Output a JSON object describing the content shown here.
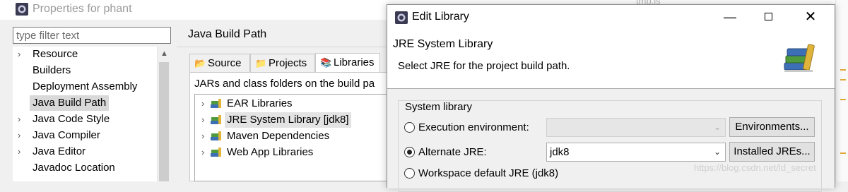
{
  "properties": {
    "title": "Properties for phant",
    "filter_placeholder": "type filter text",
    "nav": [
      {
        "label": "Resource",
        "expandable": true
      },
      {
        "label": "Builders",
        "expandable": false
      },
      {
        "label": "Deployment Assembly",
        "expandable": false
      },
      {
        "label": "Java Build Path",
        "expandable": false,
        "selected": true
      },
      {
        "label": "Java Code Style",
        "expandable": true
      },
      {
        "label": "Java Compiler",
        "expandable": true
      },
      {
        "label": "Java Editor",
        "expandable": true
      },
      {
        "label": "Javadoc Location",
        "expandable": false
      }
    ],
    "page_title": "Java Build Path",
    "tabs": [
      {
        "label": "Source",
        "icon": "source-folder-icon"
      },
      {
        "label": "Projects",
        "icon": "projects-icon"
      },
      {
        "label": "Libraries",
        "icon": "libraries-icon",
        "active": true
      }
    ],
    "tab_description": "JARs and class folders on the build pa",
    "libraries": [
      {
        "label": "EAR Libraries"
      },
      {
        "label": "JRE System Library [jdk8]",
        "selected": true
      },
      {
        "label": "Maven Dependencies"
      },
      {
        "label": "Web App Libraries"
      }
    ],
    "bg_right_text": "tmp.js"
  },
  "dialog": {
    "title": "Edit Library",
    "heading": "JRE System Library",
    "subheading": "Select JRE for the project build path.",
    "group_label": "System library",
    "options": [
      {
        "label": "Execution environment:",
        "checked": false,
        "combo_value": "",
        "combo_enabled": false,
        "button": "Environments..."
      },
      {
        "label": "Alternate JRE:",
        "checked": true,
        "combo_value": "jdk8",
        "combo_enabled": true,
        "button": "Installed JREs..."
      },
      {
        "label": "Workspace default JRE (jdk8)",
        "checked": false
      }
    ]
  },
  "watermark": "https://blog.csdn.net/ld_secret",
  "colors": {
    "selection": "#d9d9d9",
    "gutter_marker": "#e2a93b",
    "book_green": "#4f9a3c",
    "book_blue": "#3d6fb6",
    "book_yellow": "#e0b43a"
  }
}
